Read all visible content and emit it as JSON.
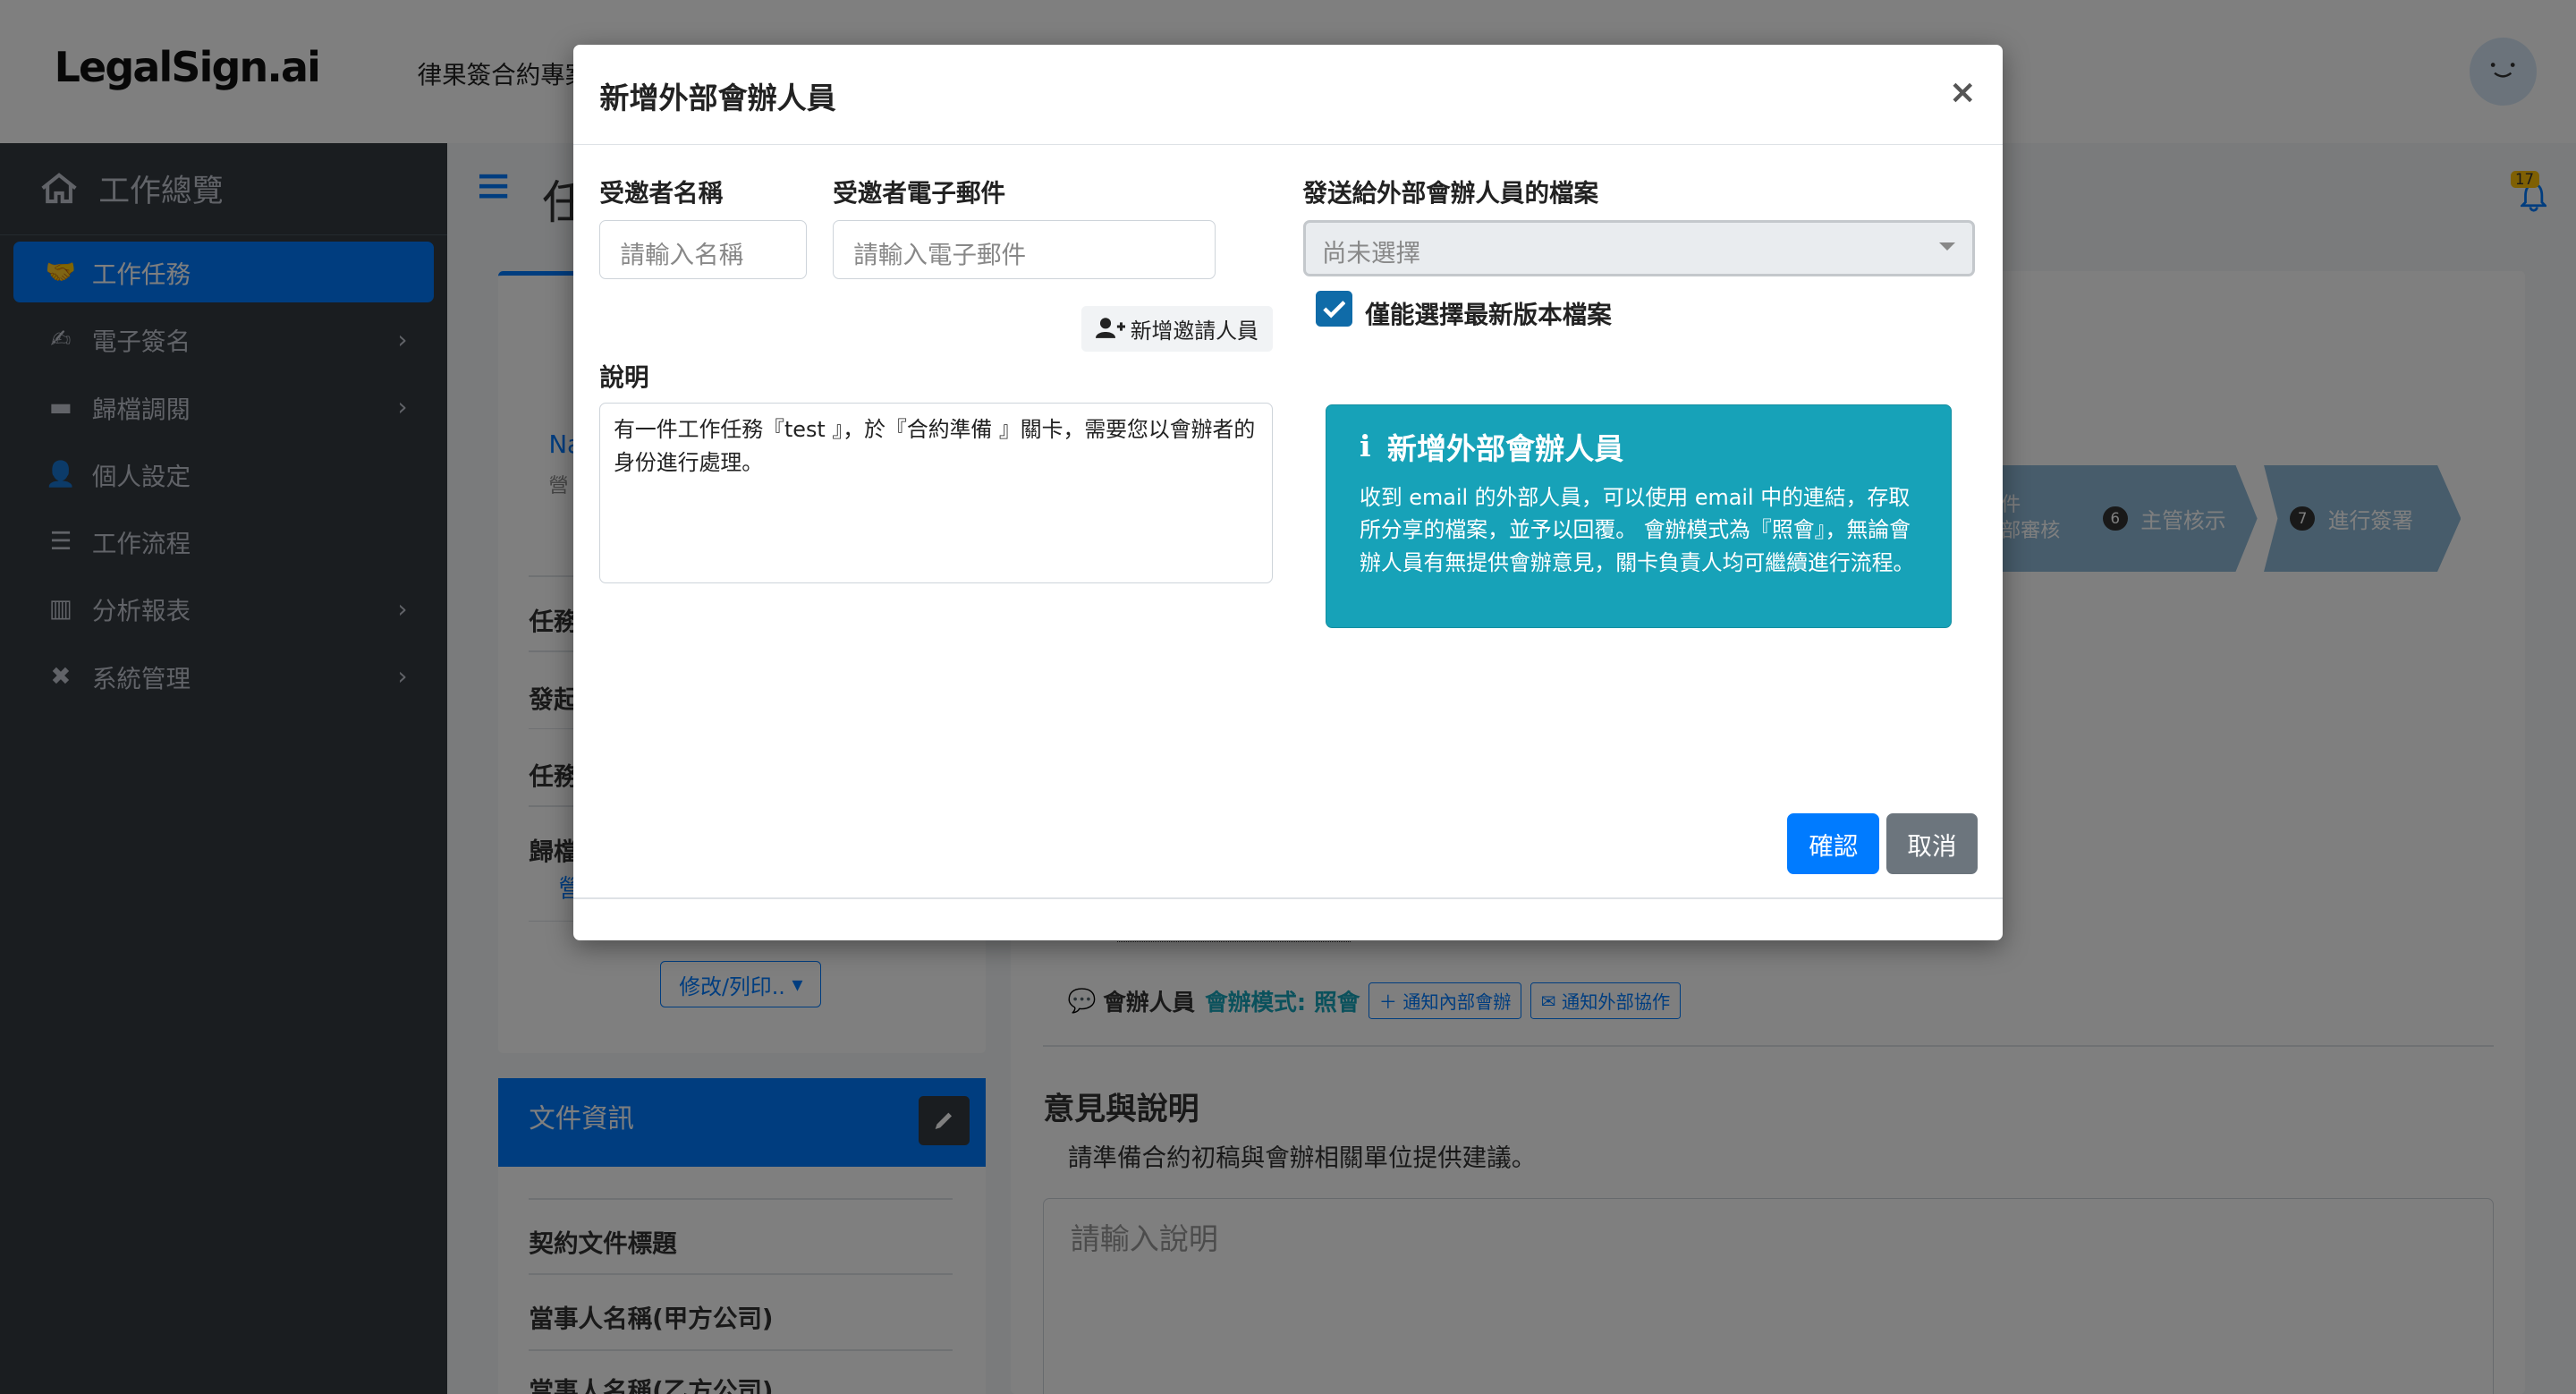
{
  "app": {
    "logo": "LegalSign.ai",
    "title": "律果簽合約專案"
  },
  "sidebar": {
    "home": "工作總覽",
    "items": [
      {
        "label": "工作任務"
      },
      {
        "label": "電子簽名"
      },
      {
        "label": "歸檔調閱"
      },
      {
        "label": "個人設定"
      },
      {
        "label": "工作流程"
      },
      {
        "label": "分析報表"
      },
      {
        "label": "系統管理"
      }
    ]
  },
  "page": {
    "heading": "任",
    "field_labels": [
      "任務",
      "發起",
      "任務",
      "歸檔"
    ],
    "modify_button": "修改/列印..",
    "doc_card_title": "文件資訊",
    "doc_fields": [
      "契約文件標題",
      "當事人名稱(甲方公司)",
      "當事人名稱(乙方公司)"
    ],
    "name_initials": "Na",
    "name_sub": "營",
    "archive_link": "營"
  },
  "steps": [
    {
      "num": "",
      "label": "件\n部審核"
    },
    {
      "num": "6",
      "label": "主管核示"
    },
    {
      "num": "7",
      "label": "進行簽署"
    }
  ],
  "cosign": {
    "label": "會辦人員",
    "mode": "會辦模式: 照會",
    "notify_internal": "通知內部會辦",
    "notify_external": "通知外部協作"
  },
  "opinion": {
    "title": "意見與說明",
    "subtitle": "請準備合約初稿與會辦相關單位提供建議。",
    "placeholder": "請輸入說明"
  },
  "notifications": {
    "count": "17"
  },
  "modal": {
    "title": "新增外部會辦人員",
    "close": "×",
    "name_label": "受邀者名稱",
    "name_placeholder": "請輸入名稱",
    "email_label": "受邀者電子郵件",
    "email_placeholder": "請輸入電子郵件",
    "add_invitee": "新增邀請人員",
    "desc_label": "說明",
    "desc_value": "有一件工作任務『test 』，於『合約準備 』關卡，需要您以會辦者的身份進行處理。",
    "files_label": "發送給外部會辦人員的檔案",
    "files_placeholder": "尚未選擇",
    "latest_only": "僅能選擇最新版本檔案",
    "info_title": "新增外部會辦人員",
    "info_body": "收到 email 的外部人員，可以使用 email 中的連結，存取所分享的檔案，並予以回覆。 會辦模式為『照會』，無論會辦人員有無提供會辦意見，關卡負責人均可繼續進行流程。",
    "confirm": "確認",
    "cancel": "取消"
  }
}
